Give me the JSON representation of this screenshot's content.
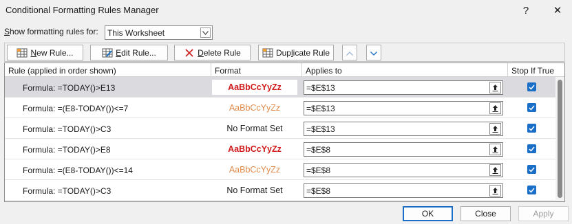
{
  "dialog": {
    "title": "Conditional Formatting Rules Manager",
    "help_glyph": "?",
    "close_glyph": "✕"
  },
  "show_rules": {
    "label_prefix": "S",
    "label_rest": "how formatting rules for:",
    "selected": "This Worksheet"
  },
  "toolbar": {
    "new_rule_u": "N",
    "new_rule_rest": "ew Rule...",
    "edit_rule_u": "E",
    "edit_rule_rest": "dit Rule...",
    "delete_rule_u": "D",
    "delete_rule_rest": "elete Rule",
    "duplicate_rule_pre": "Dup",
    "duplicate_rule_u": "l",
    "duplicate_rule_rest": "icate Rule"
  },
  "columns": {
    "rule": "Rule (applied in order shown)",
    "format": "Format",
    "applies_to": "Applies to",
    "stop_if_true": "Stop If True"
  },
  "rules": [
    {
      "rule": "Formula: =TODAY()>E13",
      "format": "AaBbCcYyZz",
      "style": "red",
      "applies_to": "=$E$13",
      "stop_if_true": true
    },
    {
      "rule": "Formula: =(E8-TODAY())<=7",
      "format": "AaBbCcYyZz",
      "style": "orange",
      "applies_to": "=$E$13",
      "stop_if_true": true
    },
    {
      "rule": "Formula: =TODAY()>C3",
      "format": "No Format Set",
      "style": "none",
      "applies_to": "=$E$13",
      "stop_if_true": true
    },
    {
      "rule": "Formula: =TODAY()>E8",
      "format": "AaBbCcYyZz",
      "style": "red",
      "applies_to": "=$E$8",
      "stop_if_true": true
    },
    {
      "rule": "Formula: =(E8-TODAY())<=14",
      "format": "AaBbCcYyZz",
      "style": "orange",
      "applies_to": "=$E$8",
      "stop_if_true": true
    },
    {
      "rule": "Formula: =TODAY()>C3",
      "format": "No Format Set",
      "style": "none",
      "applies_to": "=$E$8",
      "stop_if_true": true
    }
  ],
  "footer": {
    "ok": "OK",
    "close": "Close",
    "apply": "Apply"
  },
  "colors": {
    "accent": "#1a6ec6",
    "red_format": "#d11a1a",
    "orange_format": "#e08a4a",
    "selected_row": "#dadadf"
  }
}
